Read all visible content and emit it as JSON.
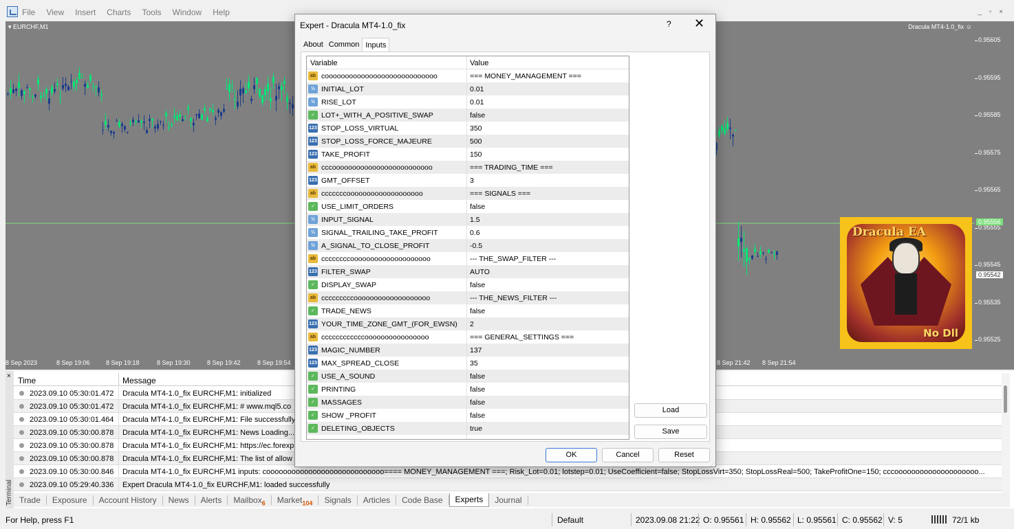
{
  "menu": [
    "File",
    "View",
    "Insert",
    "Charts",
    "Tools",
    "Window",
    "Help"
  ],
  "chart": {
    "symbol": "EURCHF,M1",
    "ea_label": "Dracula MT4-1.0_fix",
    "ea_face": "☺",
    "prices": [
      "0.95605",
      "0.95595",
      "0.95585",
      "0.95575",
      "0.95565",
      "0.95555",
      "0.95545",
      "0.95535",
      "0.95525"
    ],
    "bid_flag": "0.95556",
    "ask_flag": "0.95542",
    "times": [
      "8 Sep 2023",
      "8 Sep 19:06",
      "8 Sep 19:18",
      "8 Sep 19:30",
      "8 Sep 19:42",
      "8 Sep 19:54",
      "8 Sep 21:42",
      "8 Sep 21:54"
    ],
    "logo_title": "Dracula EA",
    "logo_sub": "No Dll",
    "colors": {
      "background": "#808080",
      "bull": "#00e676",
      "bear": "#1a3c8c",
      "bid_line": "#7ee07e"
    }
  },
  "dialog": {
    "title": "Expert - Dracula MT4-1.0_fix",
    "help": "?",
    "close": "✕",
    "tabs": [
      "About",
      "Common",
      "Inputs"
    ],
    "columns": {
      "variable": "Variable",
      "value": "Value"
    },
    "params": [
      {
        "type": "string",
        "icon": "ab",
        "name": "coooooooooooooooooooooooooooo",
        "value": "=== MONEY_MANAGEMENT ==="
      },
      {
        "type": "double",
        "icon": "½",
        "name": "INITIAL_LOT",
        "value": "0.01"
      },
      {
        "type": "double",
        "icon": "½",
        "name": "RISE_LOT",
        "value": "0.01"
      },
      {
        "type": "bool",
        "icon": "✓",
        "name": "LOT+_WITH_A_POSITIVE_SWAP",
        "value": "false"
      },
      {
        "type": "int",
        "icon": "123",
        "name": "STOP_LOSS_VIRTUAL",
        "value": "350"
      },
      {
        "type": "int",
        "icon": "123",
        "name": "STOP_LOSS_FORCE_MAJEURE",
        "value": "500"
      },
      {
        "type": "int",
        "icon": "123",
        "name": "TAKE_PROFIT",
        "value": "150"
      },
      {
        "type": "string",
        "icon": "ab",
        "name": "cccooooooooooooooooooooooooo",
        "value": "=== TRADING_TIME ==="
      },
      {
        "type": "int",
        "icon": "123",
        "name": "GMT_OFFSET",
        "value": "3"
      },
      {
        "type": "string",
        "icon": "ab",
        "name": "cccccccooooooooooooooooooo",
        "value": "=== SIGNALS ==="
      },
      {
        "type": "bool",
        "icon": "✓",
        "name": "USE_LIMIT_ORDERS",
        "value": "false"
      },
      {
        "type": "double",
        "icon": "½",
        "name": "INPUT_SIGNAL",
        "value": "1.5"
      },
      {
        "type": "double",
        "icon": "½",
        "name": "SIGNAL_TRAILING_TAKE_PROFIT",
        "value": "0.6"
      },
      {
        "type": "double",
        "icon": "½",
        "name": "A_SIGNAL_TO_CLOSE_PROFIT",
        "value": "-0.5"
      },
      {
        "type": "string",
        "icon": "ab",
        "name": "ccccccccoooooooooooooooooooo",
        "value": "--- THE_SWAP_FILTER ---"
      },
      {
        "type": "int",
        "icon": "123",
        "name": "FILTER_SWAP",
        "value": "AUTO"
      },
      {
        "type": "bool",
        "icon": "✓",
        "name": "DISPLAY_SWAP",
        "value": "false"
      },
      {
        "type": "string",
        "icon": "ab",
        "name": "cccccccccooooooooooooooooooo",
        "value": "--- THE_NEWS_FILTER ---"
      },
      {
        "type": "bool",
        "icon": "✓",
        "name": "TRADE_NEWS",
        "value": "false"
      },
      {
        "type": "int",
        "icon": "123",
        "name": "YOUR_TIME_ZONE_GMT_(FOR_EWSN)",
        "value": "2"
      },
      {
        "type": "string",
        "icon": "ab",
        "name": "ccccccccccccoooooooooooooooo",
        "value": "=== GENERAL_SETTINGS ==="
      },
      {
        "type": "int",
        "icon": "123",
        "name": "MAGIC_NUMBER",
        "value": "137"
      },
      {
        "type": "int",
        "icon": "123",
        "name": "MAX_SPREAD_CLOSE",
        "value": "35"
      },
      {
        "type": "bool",
        "icon": "✓",
        "name": "USE_A_SOUND",
        "value": "false"
      },
      {
        "type": "bool",
        "icon": "✓",
        "name": "PRINTING",
        "value": "false"
      },
      {
        "type": "bool",
        "icon": "✓",
        "name": "MASSAGES",
        "value": "false"
      },
      {
        "type": "bool",
        "icon": "✓",
        "name": "SHOW _PROFIT",
        "value": "false"
      },
      {
        "type": "bool",
        "icon": "✓",
        "name": "DELETING_OBJECTS",
        "value": "true"
      }
    ],
    "buttons": {
      "load": "Load",
      "save": "Save",
      "ok": "OK",
      "cancel": "Cancel",
      "reset": "Reset"
    }
  },
  "terminal": {
    "label": "Terminal",
    "close": "×",
    "columns": {
      "time": "Time",
      "message": "Message"
    },
    "rows": [
      {
        "time": "2023.09.10 05:30:01.472",
        "message": "Dracula MT4-1.0_fix EURCHF,M1: initialized"
      },
      {
        "time": "2023.09.10 05:30:01.472",
        "message": "Dracula MT4-1.0_fix EURCHF,M1:   # www.mql5.co"
      },
      {
        "time": "2023.09.10 05:30:01.464",
        "message": "Dracula MT4-1.0_fix EURCHF,M1: File successfully"
      },
      {
        "time": "2023.09.10 05:30:00.878",
        "message": "Dracula MT4-1.0_fix EURCHF,M1: News Loading..."
      },
      {
        "time": "2023.09.10 05:30:00.878",
        "message": "Dracula MT4-1.0_fix EURCHF,M1: https://ec.forexp"
      },
      {
        "time": "2023.09.10 05:30:00.878",
        "message": "Dracula MT4-1.0_fix EURCHF,M1: The list of allow"
      },
      {
        "time": "2023.09.10 05:30:00.846",
        "message": "Dracula MT4-1.0_fix EURCHF,M1 inputs: coooooooooooooooooooooooooooo==== MONEY_MANAGEMENT ===; Risk_Lot=0.01; lotstep=0.01; UseCoefficient=false; StopLossVirt=350; StopLossReal=500; TakeProfitOne=150; cccoooooooooooooooooooo..."
      },
      {
        "time": "2023.09.10 05:29:40.336",
        "message": "Expert Dracula MT4-1.0_fix EURCHF,M1: loaded successfully"
      }
    ],
    "tabs": [
      {
        "label": "Trade",
        "badge": ""
      },
      {
        "label": "Exposure",
        "badge": ""
      },
      {
        "label": "Account History",
        "badge": ""
      },
      {
        "label": "News",
        "badge": ""
      },
      {
        "label": "Alerts",
        "badge": ""
      },
      {
        "label": "Mailbox",
        "badge": "6"
      },
      {
        "label": "Market",
        "badge": "104"
      },
      {
        "label": "Signals",
        "badge": ""
      },
      {
        "label": "Articles",
        "badge": ""
      },
      {
        "label": "Code Base",
        "badge": ""
      },
      {
        "label": "Experts",
        "badge": ""
      },
      {
        "label": "Journal",
        "badge": ""
      }
    ],
    "active_tab": "Experts"
  },
  "statusbar": {
    "help": "For Help, press F1",
    "profile": "Default",
    "datetime": "2023.09.08 21:22",
    "open": "O: 0.95561",
    "high": "H: 0.95562",
    "low": "L: 0.95561",
    "close": "C: 0.95562",
    "volume": "V: 5",
    "traffic": "72/1 kb"
  }
}
